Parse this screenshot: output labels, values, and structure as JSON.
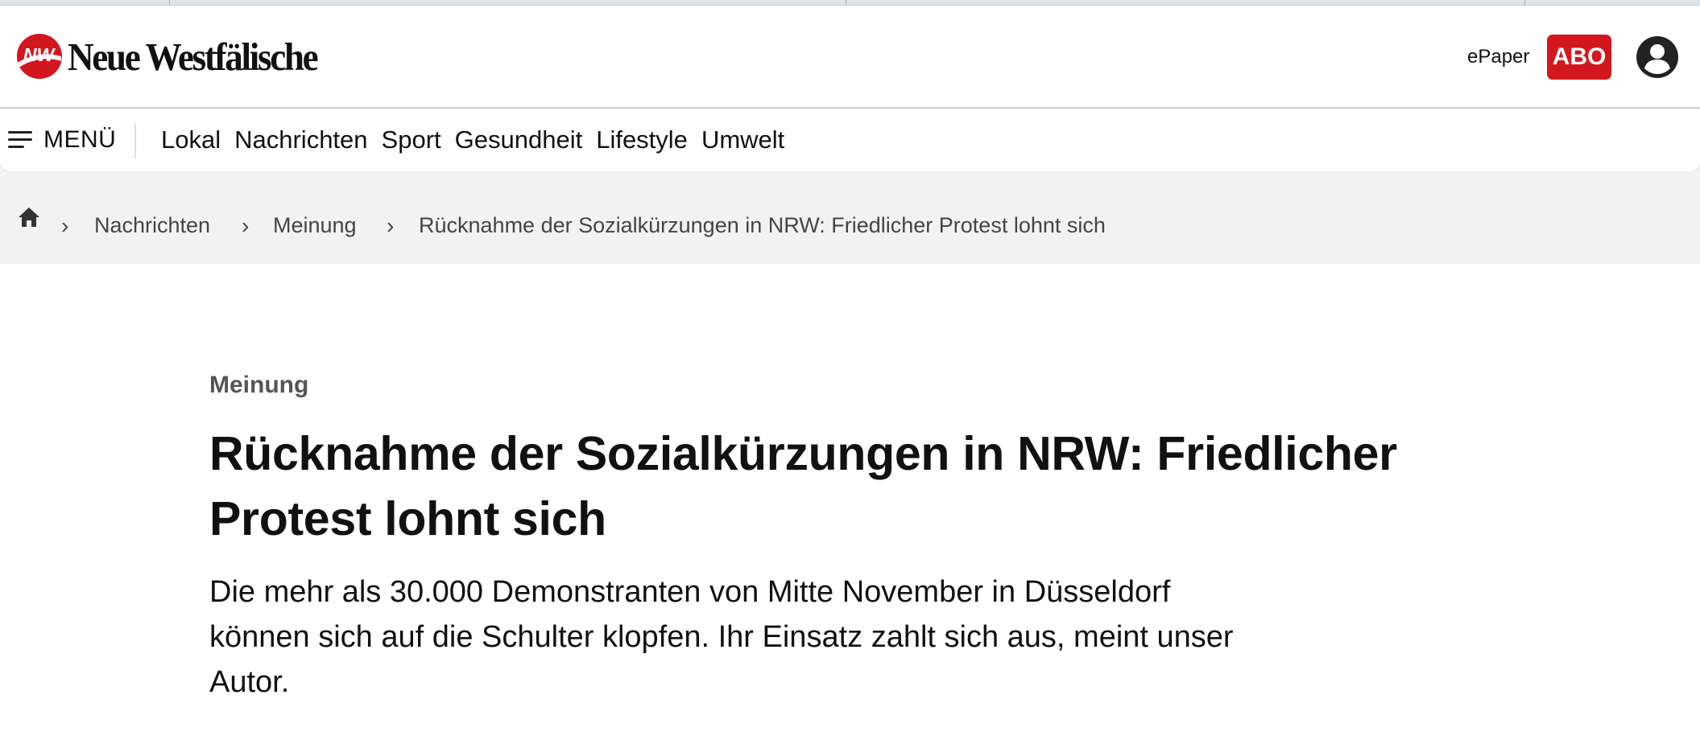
{
  "header": {
    "logo_text": "Neue Westfälische",
    "logo_mark_text": "NW",
    "epaper_label": "ePaper",
    "abo_label": "ABO",
    "brand_color": "#d3171e"
  },
  "icons": {
    "menu": "hamburger-icon",
    "home": "home-icon",
    "separator": "chevron-right-icon",
    "account": "account-icon"
  },
  "nav": {
    "menu_label": "MENÜ",
    "links": [
      "Lokal",
      "Nachrichten",
      "Sport",
      "Gesundheit",
      "Lifestyle",
      "Umwelt"
    ]
  },
  "breadcrumb": {
    "items": [
      "Nachrichten",
      "Meinung",
      "Rücknahme der Sozialkürzungen in NRW: Friedlicher Protest lohnt sich"
    ]
  },
  "article": {
    "kicker": "Meinung",
    "headline": "Rücknahme der Sozialkürzungen in NRW: Friedlicher Protest lohnt sich",
    "lead": "Die mehr als 30.000 Demonstranten von Mitte November in Düsseldorf können sich auf die Schulter klopfen. Ihr Einsatz zahlt sich aus, meint unser Autor."
  }
}
